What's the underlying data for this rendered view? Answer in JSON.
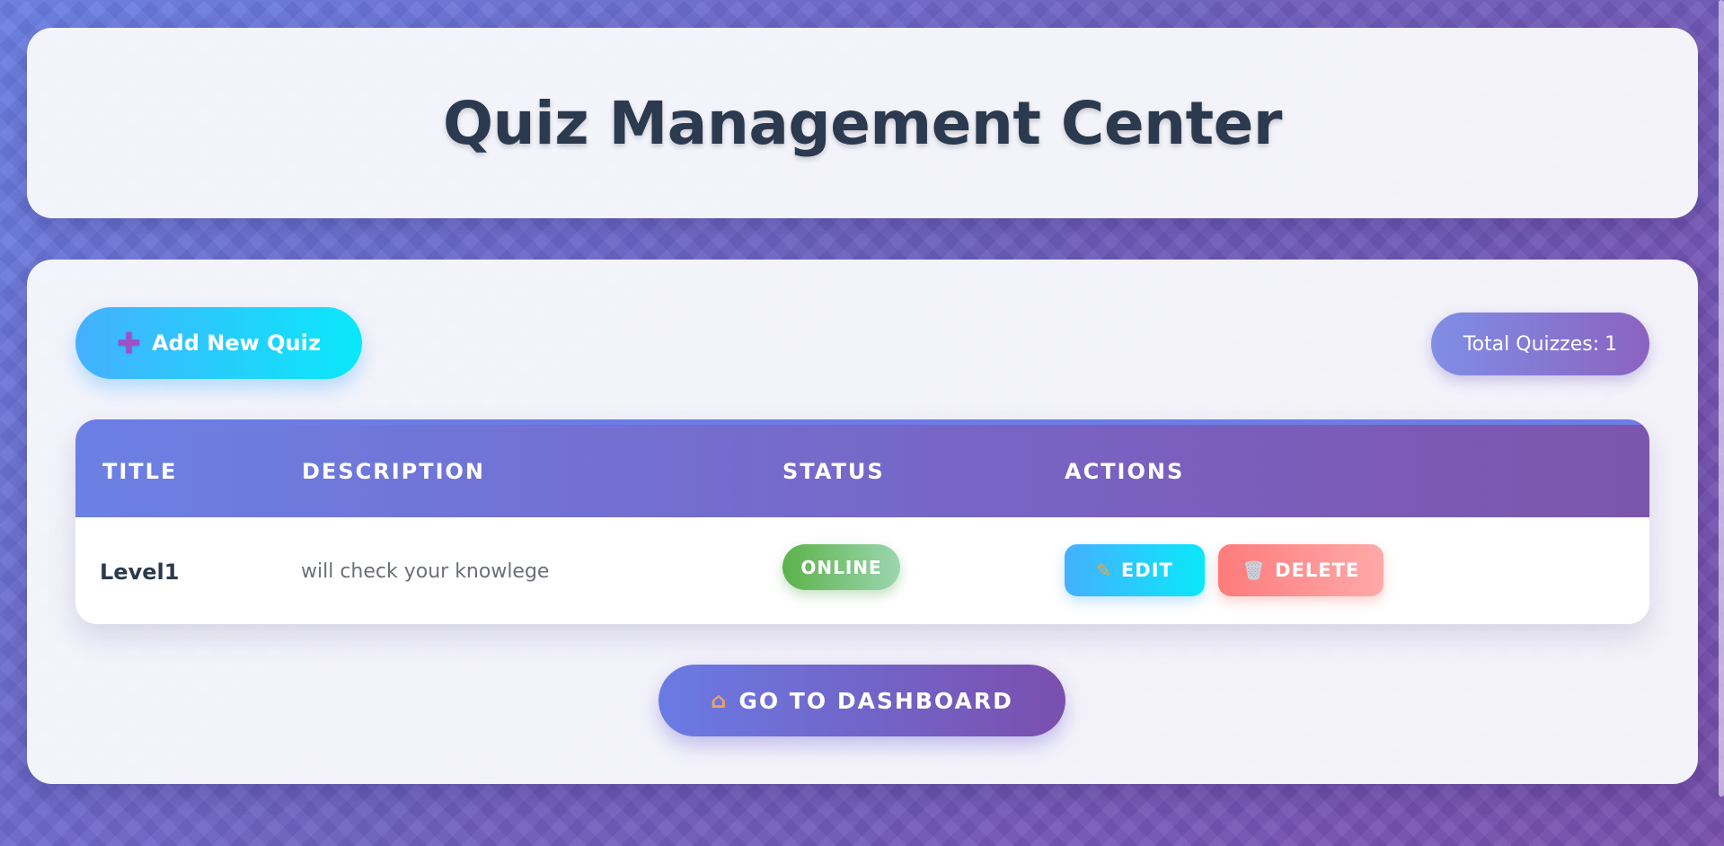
{
  "header": {
    "title": "Quiz Management Center"
  },
  "toolbar": {
    "add_icon": "plus-icon",
    "add_label": "Add New Quiz",
    "total_label": "Total Quizzes:",
    "total_count": "1"
  },
  "table": {
    "columns": [
      "TITLE",
      "DESCRIPTION",
      "STATUS",
      "ACTIONS"
    ],
    "rows": [
      {
        "title": "Level1",
        "description": "will check your knowlege",
        "status": "ONLINE",
        "edit_label": "EDIT",
        "delete_label": "DELETE"
      }
    ]
  },
  "footer": {
    "dashboard_label": "GO TO DASHBOARD",
    "dashboard_icon": "home-icon"
  },
  "colors": {
    "primary_gradient_start": "#6a7fe4",
    "primary_gradient_end": "#7a4fae",
    "accent_cyan": "#0ae8fa",
    "status_online": "#5cb24a",
    "delete_red": "#ff7b7b",
    "title_text": "#2b3a4e"
  }
}
